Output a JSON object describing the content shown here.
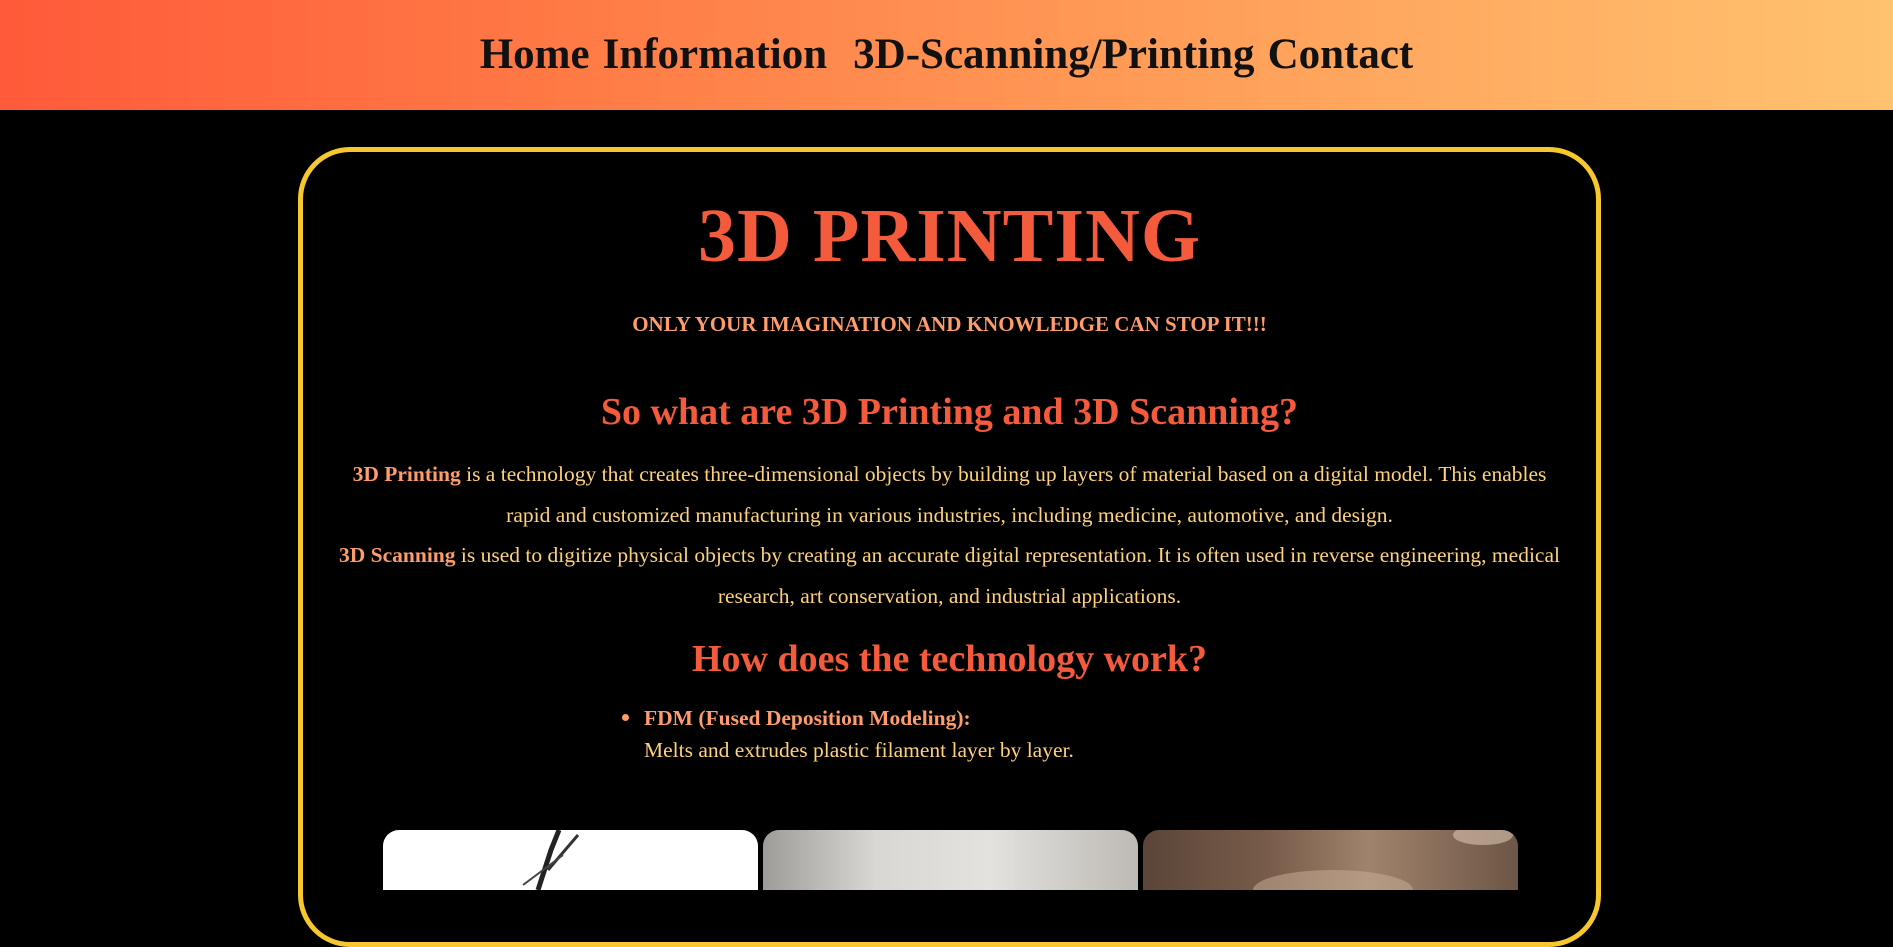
{
  "nav": {
    "items": [
      {
        "label": "Home"
      },
      {
        "label": "Information"
      },
      {
        "label": "3D-Scanning/Printing"
      },
      {
        "label": "Contact"
      }
    ]
  },
  "hero": {
    "title": "3D PRINTING",
    "tagline": "ONLY YOUR IMAGINATION AND KNOWLEDGE CAN STOP IT!!!"
  },
  "what": {
    "heading": "So what are 3D Printing and 3D Scanning?",
    "printing_term": "3D Printing",
    "printing_text": " is a technology that creates three-dimensional objects by building up layers of material based on a digital model. This enables rapid and customized manufacturing in various industries, including medicine, automotive, and design.",
    "scanning_term": "3D Scanning",
    "scanning_text": " is used to digitize physical objects by creating an accurate digital representation. It is often used in reverse engineering, medical research, art conservation, and industrial applications."
  },
  "how": {
    "heading": "How does the technology work?",
    "items": [
      {
        "name": "FDM (Fused Deposition Modeling):",
        "desc": "Melts and extrudes plastic filament layer by layer."
      }
    ]
  },
  "colors": {
    "nav_gradient_start": "#ff5a3a",
    "nav_gradient_end": "#ffc26f",
    "card_border": "#f7c82d",
    "heading": "#f35b3c",
    "term": "#ff9c6b",
    "body_text": "#ffd27a"
  }
}
